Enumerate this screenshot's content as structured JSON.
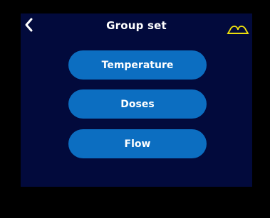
{
  "header": {
    "title": "Group set",
    "back_icon": "chevron-left-icon",
    "status_icon": "connected-tanks-icon"
  },
  "menu": {
    "items": [
      {
        "label": "Temperature"
      },
      {
        "label": "Doses"
      },
      {
        "label": "Flow"
      }
    ]
  },
  "colors": {
    "background": "#000000",
    "screen": "#020a3c",
    "button": "#0c6ec1",
    "status_icon": "#f5e60a",
    "text": "#ffffff"
  }
}
